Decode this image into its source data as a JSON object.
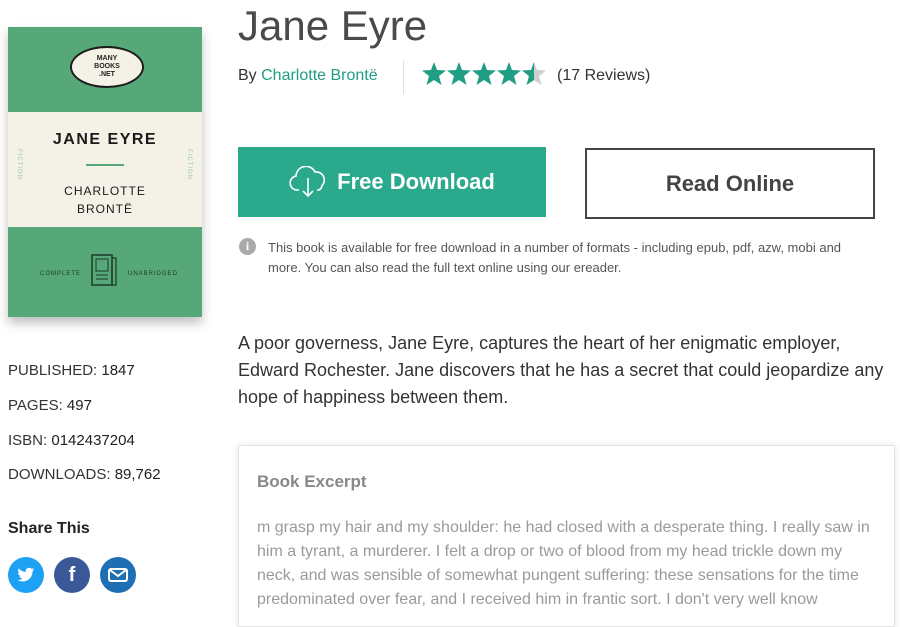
{
  "book": {
    "title": "Jane Eyre",
    "by_label": "By",
    "author": "Charlotte Brontë",
    "rating": 4.5,
    "reviews": "(17 Reviews)"
  },
  "cover": {
    "logo_line1": "MANY",
    "logo_line2": "BOOKS",
    "logo_line3": ".NET",
    "title": "JANE EYRE",
    "author_line1": "CHARLOTTE",
    "author_line2": "BRONTË",
    "side_label": "FICTION",
    "complete": "COMPLETE",
    "unabridged": "UNABRIDGED"
  },
  "meta": {
    "published_label": "PUBLISHED:",
    "published": "1847",
    "pages_label": "PAGES:",
    "pages": "497",
    "isbn_label": "ISBN:",
    "isbn": "0142437204",
    "downloads_label": "DOWNLOADS:",
    "downloads": "89,762"
  },
  "share": {
    "title": "Share This",
    "buttons": [
      {
        "icon": "twitter-icon",
        "glyph": "🐦",
        "color": "#1da1f2"
      },
      {
        "icon": "facebook-icon",
        "glyph": "f",
        "color": "#3b5998"
      },
      {
        "icon": "email-icon",
        "glyph": "✉",
        "color": "#1f6fb5"
      }
    ]
  },
  "actions": {
    "download_label": "Free Download",
    "read_label": "Read Online"
  },
  "info": "This book is available for free download in a number of formats - including epub, pdf, azw, mobi and more. You can also read the full text online using our ereader.",
  "description": "A poor governess, Jane Eyre, captures the heart of her enigmatic employer, Edward Rochester. Jane discovers that he has a secret that could jeopardize any hope of happiness between them.",
  "excerpt": {
    "title": "Book Excerpt",
    "text": "m grasp my hair and my shoulder: he had closed with a desperate thing. I really saw in him a tyrant, a murderer. I felt a drop or two of blood from my head trickle down my neck, and was sensible of somewhat pungent suffering: these sensations for the time predominated over fear, and I received him in frantic sort. I don't very well know"
  },
  "colors": {
    "accent": "#2aa98c",
    "star": "#1f9e84",
    "cover_green": "#56a878"
  }
}
